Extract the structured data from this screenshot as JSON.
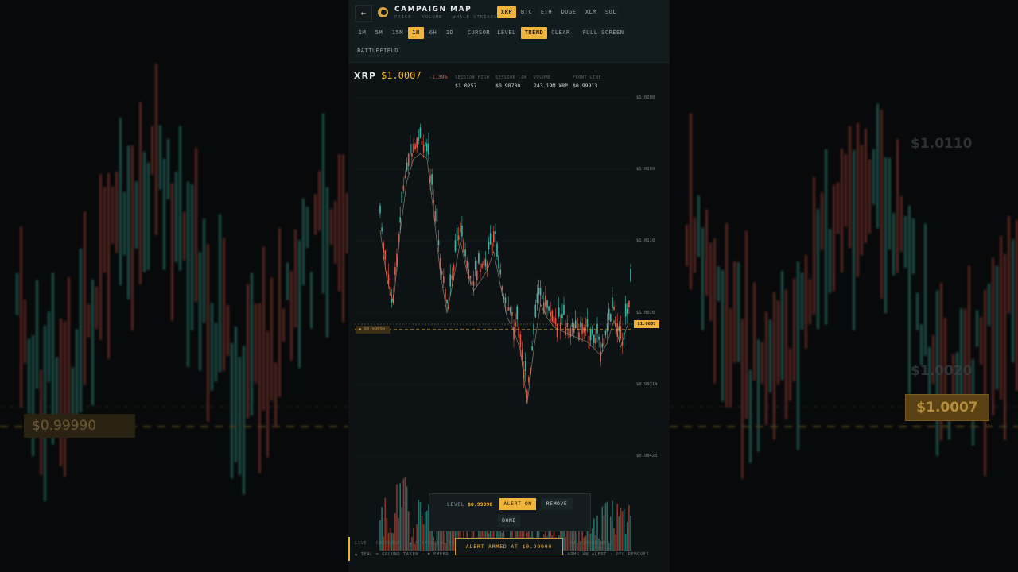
{
  "background": {
    "left_label": "$0.99990",
    "right_labels": [
      "$1.0110",
      "$1.0020"
    ],
    "right_badge": "$1.0007"
  },
  "header": {
    "back_icon": "arrow-left-icon",
    "logo_icon": "coin-logo-icon",
    "title": "CAMPAIGN MAP",
    "subtitle": "PRICE · VOLUME · WHALE STRIKES",
    "assets": [
      {
        "label": "XRP",
        "active": true
      },
      {
        "label": "BTC",
        "active": false
      },
      {
        "label": "ETH",
        "active": false
      },
      {
        "label": "DOGE",
        "active": false
      },
      {
        "label": "XLM",
        "active": false
      },
      {
        "label": "SOL",
        "active": false
      }
    ],
    "timeframes": [
      {
        "label": "1M",
        "active": false
      },
      {
        "label": "5M",
        "active": false
      },
      {
        "label": "15M",
        "active": false
      },
      {
        "label": "1H",
        "active": true
      },
      {
        "label": "6H",
        "active": false
      },
      {
        "label": "1D",
        "active": false
      }
    ],
    "tools": [
      {
        "label": "CURSOR",
        "active": false
      },
      {
        "label": "LEVEL",
        "active": false
      },
      {
        "label": "TREND",
        "active": true
      },
      {
        "label": "CLEAR",
        "active": false
      }
    ],
    "full_screen": "FULL SCREEN",
    "battlefield": "BATTLEFIELD"
  },
  "ticker": {
    "symbol": "XRP",
    "price": "$1.0007",
    "change": "-1.39%",
    "stats": [
      {
        "label": "SESSION HIGH",
        "value": "$1.0257"
      },
      {
        "label": "SESSION LOW",
        "value": "$0.98730"
      },
      {
        "label": "VOLUME",
        "value": "243.19M XRP"
      },
      {
        "label": "FRONT LINE",
        "value": "$0.99913"
      }
    ]
  },
  "chart_data": {
    "type": "candlestick",
    "y_axis_labels": [
      "$1.0200",
      "$1.0199",
      "$1.0110",
      "$1.0020",
      "$0.99314",
      "$0.98423"
    ],
    "last_price_label": "$1.0007",
    "level_label": "$0.99990",
    "grid": true,
    "colors": {
      "up": "#3fb8a8",
      "down": "#e05b47",
      "ma": "#b8a88a",
      "level": "#f0b43a"
    }
  },
  "popup": {
    "level_label": "LEVEL",
    "level_value": "$0.99990",
    "alert_on": "ALERT ON",
    "remove": "REMOVE",
    "done": "DONE"
  },
  "footer": {
    "line1": "LIVE · COINBASE · ▲ 0 WATCHING FOR ·",
    "line1_tail": "ET PINNED HERE",
    "line2": "▲ TEAL = GROUND TAKEN · ▼ EMBER ·",
    "line2_tail": "A ARMS AN ALERT · DEL REMOVES",
    "toast": "ALERT ARMED AT $0.99990"
  }
}
